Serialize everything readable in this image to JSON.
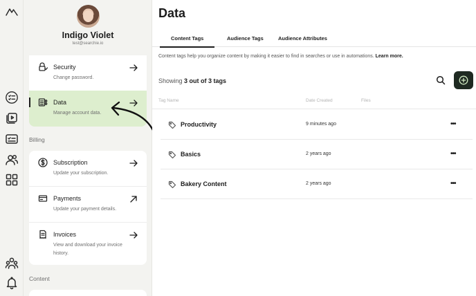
{
  "profile": {
    "name": "Indigo Violet",
    "email": "test@searchie.io"
  },
  "settings": {
    "security": {
      "title": "Security",
      "subtitle": "Change password."
    },
    "data": {
      "title": "Data",
      "subtitle": "Manage account data."
    },
    "billing_label": "Billing",
    "subscription": {
      "title": "Subscription",
      "subtitle": "Update your subscription."
    },
    "payments": {
      "title": "Payments",
      "subtitle": "Update your payment details."
    },
    "invoices": {
      "title": "Invoices",
      "subtitle": "View and download your invoice history."
    },
    "content_label": "Content"
  },
  "main": {
    "title": "Data",
    "tabs": [
      "Content Tags",
      "Audience Tags",
      "Audience Attributes"
    ],
    "description": "Content tags help you organize content by making it easier to find in searches or use in automations.",
    "learn_more": "Learn more.",
    "showing_prefix": "Showing",
    "showing_count": "3 out of 3 tags",
    "columns": [
      "Tag Name",
      "Date Created",
      "Files"
    ],
    "tags": [
      {
        "name": "Productivity",
        "date": "9 minutes ago",
        "more": "•••"
      },
      {
        "name": "Basics",
        "date": "2 years ago",
        "more": "•••"
      },
      {
        "name": "Bakery Content",
        "date": "2 years ago",
        "more": "•••"
      }
    ]
  },
  "colors": {
    "accent_dark": "#1f2a22",
    "active_card": "#ddeece",
    "panel_bg": "#f3f3f0"
  }
}
